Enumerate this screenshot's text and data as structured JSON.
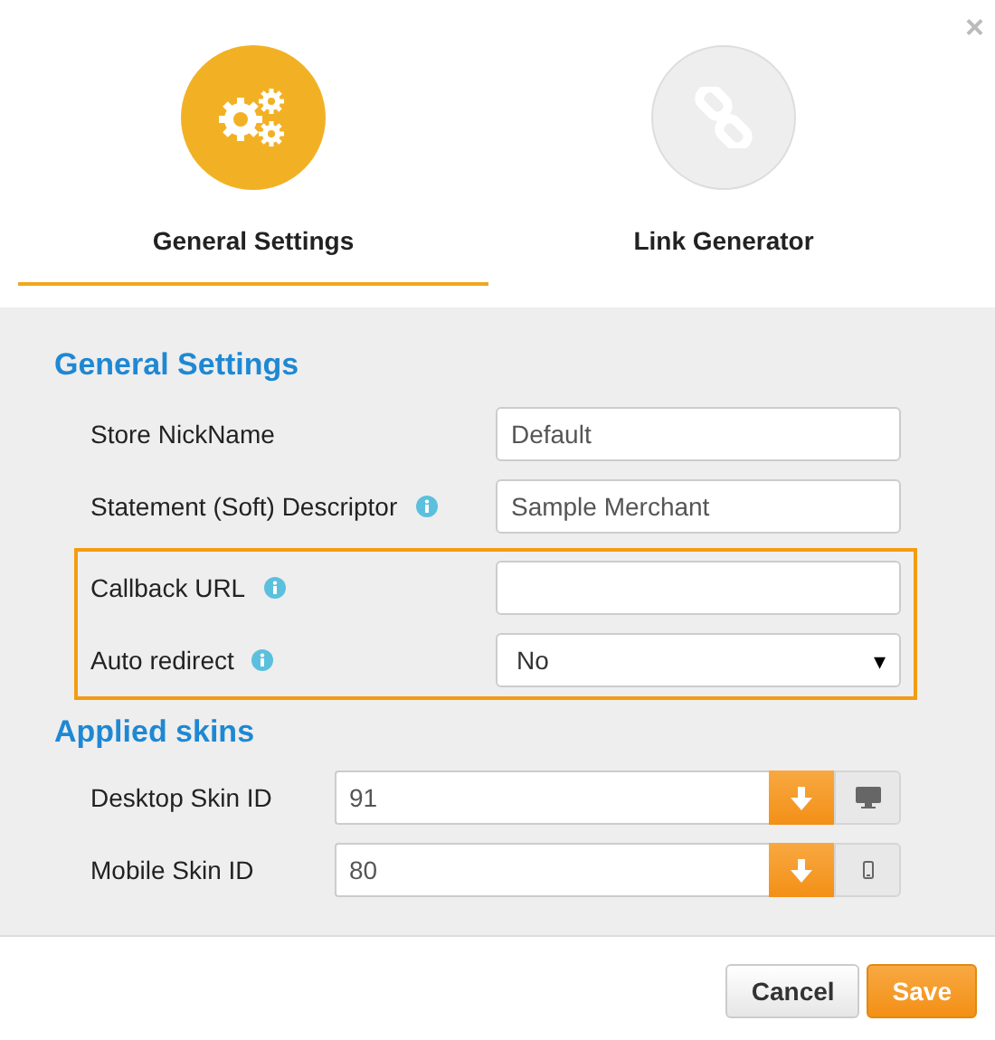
{
  "close": "×",
  "tabs": [
    {
      "label": "General Settings",
      "kind": "gears",
      "selected": true
    },
    {
      "label": "Link Generator",
      "kind": "link",
      "selected": false
    }
  ],
  "general": {
    "title": "General Settings",
    "groups": [
      {
        "highlighted": false,
        "fields": [
          {
            "label": "Store NickName",
            "info": false,
            "kind": "text",
            "value": "Default"
          },
          {
            "label": "Statement (Soft) Descriptor",
            "info": true,
            "kind": "text",
            "value": "Sample Merchant"
          }
        ]
      },
      {
        "highlighted": true,
        "fields": [
          {
            "label": "Callback URL",
            "info": true,
            "kind": "text"
          },
          {
            "label": "Auto redirect",
            "info": true,
            "kind": "select",
            "value": "No",
            "caret": "▾"
          }
        ]
      }
    ]
  },
  "skins": {
    "title": "Applied skins",
    "rows": [
      {
        "label": "Desktop Skin ID",
        "value": "91",
        "kind": "desktop"
      },
      {
        "label": "Mobile Skin ID",
        "value": "80",
        "kind": "mobile"
      }
    ]
  },
  "buttons": [
    {
      "label": "Cancel",
      "kind": "default"
    },
    {
      "label": "Save",
      "kind": "primary"
    }
  ]
}
